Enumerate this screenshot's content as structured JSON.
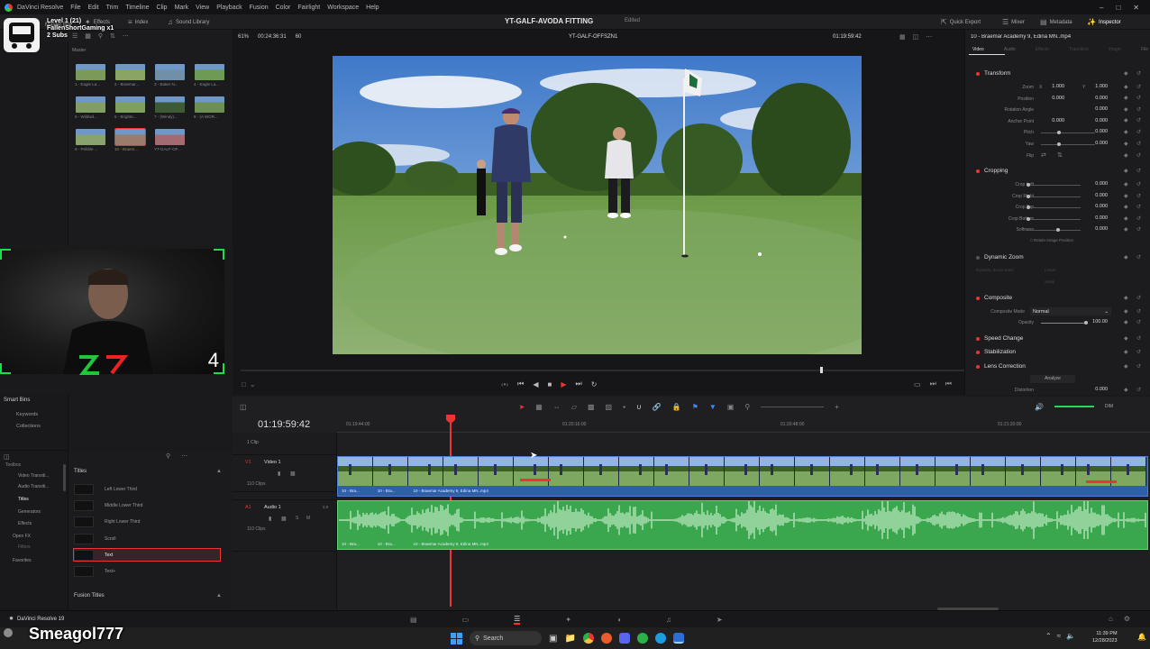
{
  "menubar": {
    "app_name": "DaVinci Resolve",
    "items": [
      "File",
      "Edit",
      "Trim",
      "Timeline",
      "Clip",
      "Mark",
      "View",
      "Playback",
      "Fusion",
      "Color",
      "Fairlight",
      "Workspace",
      "Help"
    ]
  },
  "toolbar": {
    "master_bin": "Master Bin",
    "effects": "Effects",
    "index": "Index",
    "sound_library": "Sound Library",
    "project_title": "YT-GALF-AVODA FITTING",
    "project_status": "Edited",
    "quick_export": "Quick Export",
    "mixer": "Mixer",
    "metadata": "Metadata",
    "inspector": "Inspector"
  },
  "overlay": {
    "level": "Level 1  (21)",
    "user": "FallenShortGaming x1",
    "subs": "2 Subs"
  },
  "media_pool": {
    "master_label": "Master",
    "clips": [
      {
        "label": "1 - Eagle La...",
        "color": "#7b9a5a"
      },
      {
        "label": "2 - Braemar...",
        "color": "#8aa464"
      },
      {
        "label": "3 - Baker N...",
        "color": "#6f90a8"
      },
      {
        "label": "4 - Eagle La...",
        "color": "#6d9b55"
      },
      {
        "label": "5 - Wildwd...",
        "color": "#829e64"
      },
      {
        "label": "6 - Brighte...",
        "color": "#7fa060"
      },
      {
        "label": "7 - (Windy)...",
        "color": "#3e5a36"
      },
      {
        "label": "8 - (A WOR...",
        "color": "#6c9054"
      },
      {
        "label": "9 - Pebble ...",
        "color": "#88a36c"
      },
      {
        "label": "10 - Braem...",
        "color": "#9b7b6a"
      },
      {
        "label": "YT-GALF-OF...",
        "color": "#a46a72"
      }
    ]
  },
  "webcam": {
    "count": "4"
  },
  "smart_bins": {
    "title": "Smart Bins",
    "items": [
      "Keywords",
      "Collections"
    ]
  },
  "effects_panel": {
    "toolbox": "Toolbox",
    "categories": [
      "Video Transiti...",
      "Audio Transiti...",
      "Titles",
      "Generators",
      "Effects",
      "Open FX",
      "Filters"
    ],
    "favorites": "Favorites",
    "section_title": "Titles",
    "items": [
      "Left Lower Third",
      "Middle Lower Third",
      "Right Lower Third",
      "Scroll",
      "Text",
      "Text+"
    ],
    "selected": "Text",
    "fusion_titles": "Fusion Titles"
  },
  "viewer": {
    "zoom": "61%",
    "source_timecode": "00:24:36:31",
    "fps": "60",
    "timeline_name": "YT-GALF-OFFSZN1",
    "record_timecode": "01:19:59:42"
  },
  "inspector": {
    "clip_name": "10 - Braemar Academy 9, Edina MN..mp4",
    "tabs": [
      "Video",
      "Audio",
      "Effects",
      "Transition",
      "Image",
      "File"
    ],
    "transform": {
      "title": "Transform",
      "zoom_label": "Zoom",
      "zoom_x": "1.000",
      "zoom_y": "1.000",
      "position_label": "Position",
      "position_x": "0.000",
      "position_y": "0.000",
      "rotation_label": "Rotation Angle",
      "rotation": "0.000",
      "anchor_label": "Anchor Point",
      "anchor_x": "0.000",
      "anchor_y": "0.000",
      "pitch_label": "Pitch",
      "pitch": "0.000",
      "yaw_label": "Yaw",
      "yaw": "0.000",
      "flip_label": "Flip"
    },
    "cropping": {
      "title": "Cropping",
      "crop_left_label": "Crop Left",
      "crop_left": "0.000",
      "crop_right_label": "Crop Right",
      "crop_right": "0.000",
      "crop_top_label": "Crop Top",
      "crop_top": "0.000",
      "crop_bottom_label": "Crop Bottom",
      "crop_bottom": "0.000",
      "softness_label": "Softness",
      "softness": "0.000",
      "retain_label": "Retain Image Position"
    },
    "dynamic_zoom": {
      "title": "Dynamic Zoom",
      "ease_label": "Dynamic Zoom Ease",
      "ease_value": "Linear",
      "swap": "Swap"
    },
    "composite": {
      "title": "Composite",
      "mode_label": "Composite Mode",
      "mode": "Normal",
      "opacity_label": "Opacity",
      "opacity": "100.00"
    },
    "speed_change": "Speed Change",
    "stabilization": "Stabilization",
    "lens_correction": {
      "title": "Lens Correction",
      "analyze": "Analyze",
      "distortion_label": "Distortion",
      "distortion": "0.000"
    }
  },
  "timeline": {
    "timecode": "01:19:59:42",
    "ruler_marks": [
      "01:19:44:00",
      "01:20:16:00",
      "01:20:48:00",
      "01:21:20:00"
    ],
    "clip_count": "1 Clip",
    "video_track": {
      "id": "V1",
      "name": "Video 1",
      "clips": "110 Clips",
      "clip_label": "10 - Braemar Academy 9, Edina MN..mp4",
      "short_labels": [
        "10 - Bra...",
        "10 - Bra..."
      ]
    },
    "audio_track": {
      "id": "A1",
      "name": "Audio 1",
      "level": "2.0",
      "clips": "110 Clips",
      "clip_label": "10 - Braemar Academy 9, Edina MN..mp4",
      "short_labels": [
        "10 - Bra...",
        "10 - Bra..."
      ],
      "mute": "M",
      "solo": "S"
    },
    "audio_meter": "DIM"
  },
  "bottom": {
    "app_version": "DaVinci Resolve 19",
    "streamer": "Smeagol777",
    "search_placeholder": "Search",
    "clock_time": "11:39 PM",
    "clock_date": "12/28/2023"
  }
}
